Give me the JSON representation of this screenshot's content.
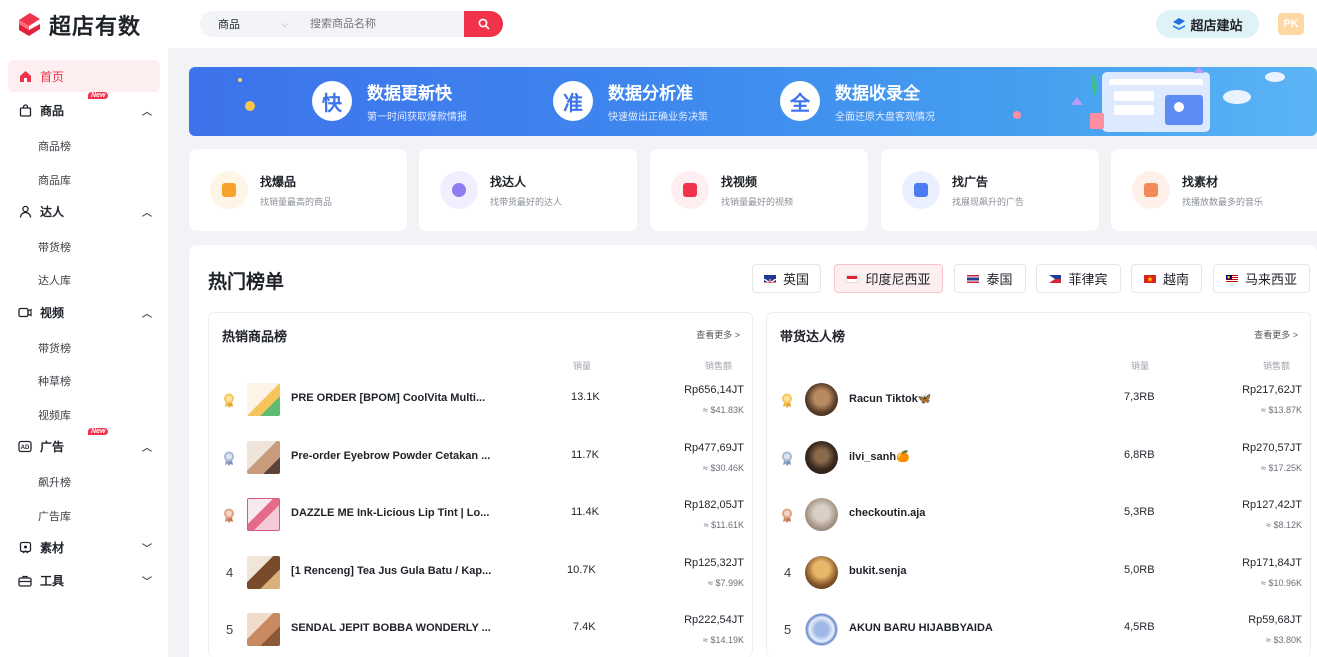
{
  "header": {
    "logo_text": "超店有数",
    "search_category": "商品",
    "search_placeholder": "搜索商品名称",
    "build_label": "超店建站",
    "avatar_initials": "PK"
  },
  "sidebar": {
    "home": "首页",
    "new_badge": "New",
    "groups": [
      {
        "label": "商品",
        "items": [
          "商品榜",
          "商品库"
        ]
      },
      {
        "label": "达人",
        "items": [
          "带货榜",
          "达人库"
        ]
      },
      {
        "label": "视频",
        "items": [
          "带货榜",
          "种草榜",
          "视频库"
        ]
      },
      {
        "label": "广告",
        "items": [
          "飙升榜",
          "广告库"
        ]
      },
      {
        "label": "素材",
        "items": []
      },
      {
        "label": "工具",
        "items": []
      }
    ]
  },
  "banner": {
    "features": [
      {
        "badge": "快",
        "title": "数据更新快",
        "subtitle": "第一时间获取爆款情报"
      },
      {
        "badge": "准",
        "title": "数据分析准",
        "subtitle": "快速做出正确业务决策"
      },
      {
        "badge": "全",
        "title": "数据收录全",
        "subtitle": "全面还原大盘客观情况"
      }
    ]
  },
  "quick_cards": [
    {
      "title": "找爆品",
      "subtitle": "找销量最高的商品",
      "color": "#f7a22b",
      "bg": "#fff5e6"
    },
    {
      "title": "找达人",
      "subtitle": "找带货最好的达人",
      "color": "#8e7ef2",
      "bg": "#f1efff"
    },
    {
      "title": "找视频",
      "subtitle": "找销量最好的视频",
      "color": "#f0324b",
      "bg": "#feeef0"
    },
    {
      "title": "找广告",
      "subtitle": "找展现飙升的广告",
      "color": "#4d7cf2",
      "bg": "#eaf0ff"
    },
    {
      "title": "找素材",
      "subtitle": "找播放数最多的音乐",
      "color": "#f28a5a",
      "bg": "#fff1ea"
    }
  ],
  "rankings": {
    "title": "热门榜单",
    "countries": [
      "英国",
      "印度尼西亚",
      "泰国",
      "菲律宾",
      "越南",
      "马来西亚"
    ],
    "active_country": "印度尼西亚",
    "products": {
      "title": "热销商品榜",
      "more": "查看更多 >",
      "col_sales": "销量",
      "col_amount": "销售额",
      "rows": [
        {
          "rank": "1",
          "name": "PRE ORDER [BPOM] CoolVita Multi...",
          "sales": "13.1K",
          "amount": "Rp656,14JT",
          "usd": "≈ $41.83K"
        },
        {
          "rank": "2",
          "name": "Pre-order Eyebrow Powder Cetakan ...",
          "sales": "11.7K",
          "amount": "Rp477,69JT",
          "usd": "≈ $30.46K"
        },
        {
          "rank": "3",
          "name": "DAZZLE ME Ink-Licious Lip Tint | Lo...",
          "sales": "11.4K",
          "amount": "Rp182,05JT",
          "usd": "≈ $11.61K"
        },
        {
          "rank": "4",
          "name": "[1 Renceng] Tea Jus Gula Batu / Kap...",
          "sales": "10.7K",
          "amount": "Rp125,32JT",
          "usd": "≈ $7.99K"
        },
        {
          "rank": "5",
          "name": "SENDAL JEPIT BOBBA WONDERLY ...",
          "sales": "7.4K",
          "amount": "Rp222,54JT",
          "usd": "≈ $14.19K"
        }
      ]
    },
    "creators": {
      "title": "带货达人榜",
      "more": "查看更多 >",
      "col_sales": "销量",
      "col_amount": "销售额",
      "rows": [
        {
          "rank": "1",
          "name": "Racun Tiktok🦋",
          "sales": "7,3RB",
          "amount": "Rp217,62JT",
          "usd": "≈ $13.87K"
        },
        {
          "rank": "2",
          "name": "ilvi_sanh🍊",
          "sales": "6,8RB",
          "amount": "Rp270,57JT",
          "usd": "≈ $17.25K"
        },
        {
          "rank": "3",
          "name": "checkoutin.aja",
          "sales": "5,3RB",
          "amount": "Rp127,42JT",
          "usd": "≈ $8.12K"
        },
        {
          "rank": "4",
          "name": "bukit.senja",
          "sales": "5,0RB",
          "amount": "Rp171,84JT",
          "usd": "≈ $10.96K"
        },
        {
          "rank": "5",
          "name": "AKUN BARU HIJABBYAIDA",
          "sales": "4,5RB",
          "amount": "Rp59,68JT",
          "usd": "≈ $3.80K"
        }
      ]
    }
  }
}
